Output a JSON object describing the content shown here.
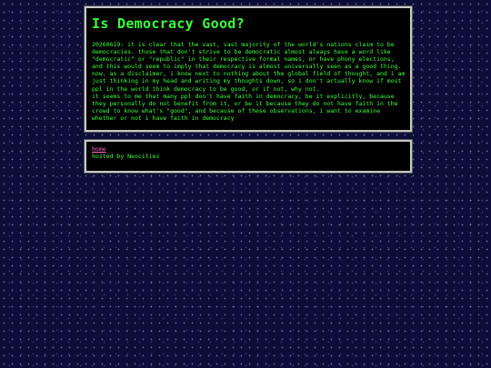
{
  "page": {
    "title": "Is Democracy Good?",
    "paragraphs": [
      "20260619: it is clear that the vast, vast majority of the world's nations claim to be democracies. those that don't strive to be democratic almost always have a word like \"democratic\" or \"republic\" in their respective formal names, or have phony elections, and this would seem to imply that democracy is almost universally seen as a good thing.",
      "now, as a disclaimer, i know next to nothing about the global field of thought, and i am just thinking in my head and writing my thoughts down, so i don't actually know if most ppl in the world think democracy to be good, or if not, why not.",
      "it seems to me that many ppl don't have faith in democracy, be it explicitly, because they personally do not benefit from it, or be it because they do not have faith in the crowd to know what's \"good\", and because of these observations, i want to examine whether or not i have faith in democracy"
    ]
  },
  "footer": {
    "home_label": "home",
    "hosted_text": "hosted by Neocities"
  },
  "colors": {
    "background": "#0d0d3a",
    "panel": "#000000",
    "text": "#3dff3d",
    "link": "#ff66cc",
    "border": "#c8c8c8"
  }
}
